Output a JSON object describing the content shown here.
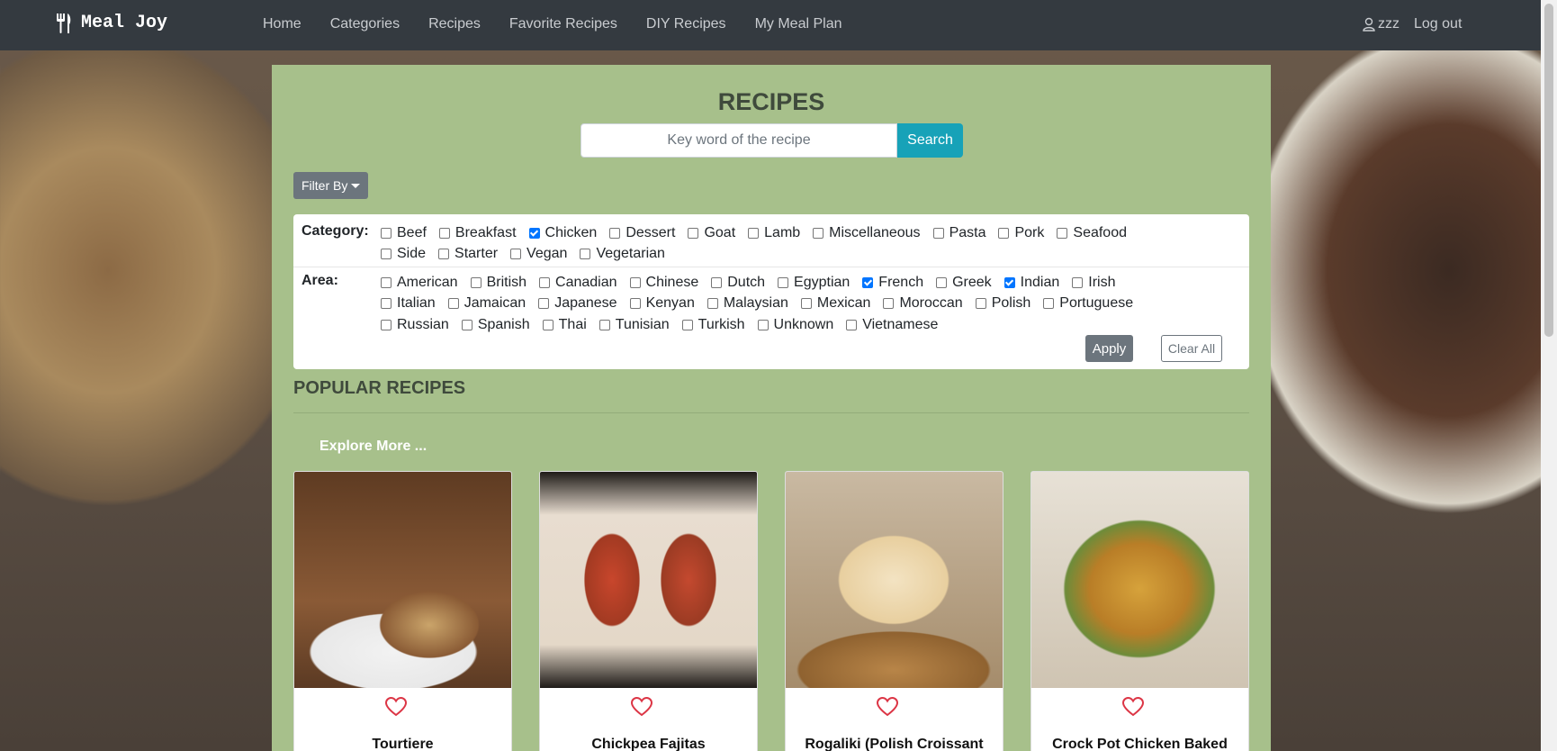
{
  "navbar": {
    "brand": "Meal Joy",
    "links": [
      "Home",
      "Categories",
      "Recipes",
      "Favorite Recipes",
      "DIY Recipes",
      "My Meal Plan"
    ],
    "username": "zzz",
    "logout": "Log out"
  },
  "page": {
    "title": "RECIPES",
    "search_placeholder": "Key word of the recipe",
    "search_button": "Search",
    "filter_button": "Filter By"
  },
  "filters": {
    "category_label": "Category:",
    "categories": [
      {
        "label": "Beef",
        "checked": false
      },
      {
        "label": "Breakfast",
        "checked": false
      },
      {
        "label": "Chicken",
        "checked": true
      },
      {
        "label": "Dessert",
        "checked": false
      },
      {
        "label": "Goat",
        "checked": false
      },
      {
        "label": "Lamb",
        "checked": false
      },
      {
        "label": "Miscellaneous",
        "checked": false
      },
      {
        "label": "Pasta",
        "checked": false
      },
      {
        "label": "Pork",
        "checked": false
      },
      {
        "label": "Seafood",
        "checked": false
      },
      {
        "label": "Side",
        "checked": false
      },
      {
        "label": "Starter",
        "checked": false
      },
      {
        "label": "Vegan",
        "checked": false
      },
      {
        "label": "Vegetarian",
        "checked": false
      }
    ],
    "area_label": "Area:",
    "areas": [
      {
        "label": "American",
        "checked": false
      },
      {
        "label": "British",
        "checked": false
      },
      {
        "label": "Canadian",
        "checked": false
      },
      {
        "label": "Chinese",
        "checked": false
      },
      {
        "label": "Dutch",
        "checked": false
      },
      {
        "label": "Egyptian",
        "checked": false
      },
      {
        "label": "French",
        "checked": true
      },
      {
        "label": "Greek",
        "checked": false
      },
      {
        "label": "Indian",
        "checked": true
      },
      {
        "label": "Irish",
        "checked": false
      },
      {
        "label": "Italian",
        "checked": false
      },
      {
        "label": "Jamaican",
        "checked": false
      },
      {
        "label": "Japanese",
        "checked": false
      },
      {
        "label": "Kenyan",
        "checked": false
      },
      {
        "label": "Malaysian",
        "checked": false
      },
      {
        "label": "Mexican",
        "checked": false
      },
      {
        "label": "Moroccan",
        "checked": false
      },
      {
        "label": "Polish",
        "checked": false
      },
      {
        "label": "Portuguese",
        "checked": false
      },
      {
        "label": "Russian",
        "checked": false
      },
      {
        "label": "Spanish",
        "checked": false
      },
      {
        "label": "Thai",
        "checked": false
      },
      {
        "label": "Tunisian",
        "checked": false
      },
      {
        "label": "Turkish",
        "checked": false
      },
      {
        "label": "Unknown",
        "checked": false
      },
      {
        "label": "Vietnamese",
        "checked": false
      }
    ],
    "apply": "Apply",
    "clear_all": "Clear All"
  },
  "popular": {
    "heading": "POPULAR RECIPES",
    "explore": "Explore More ...",
    "recipes": [
      {
        "name": "Tourtiere"
      },
      {
        "name": "Chickpea Fajitas"
      },
      {
        "name": "Rogaliki (Polish Croissant"
      },
      {
        "name": "Crock Pot Chicken Baked"
      }
    ]
  },
  "colors": {
    "navbar": "#343a40",
    "panel": "#a7c08b",
    "search_button": "#17a2b8",
    "heart": "#dc3545"
  }
}
